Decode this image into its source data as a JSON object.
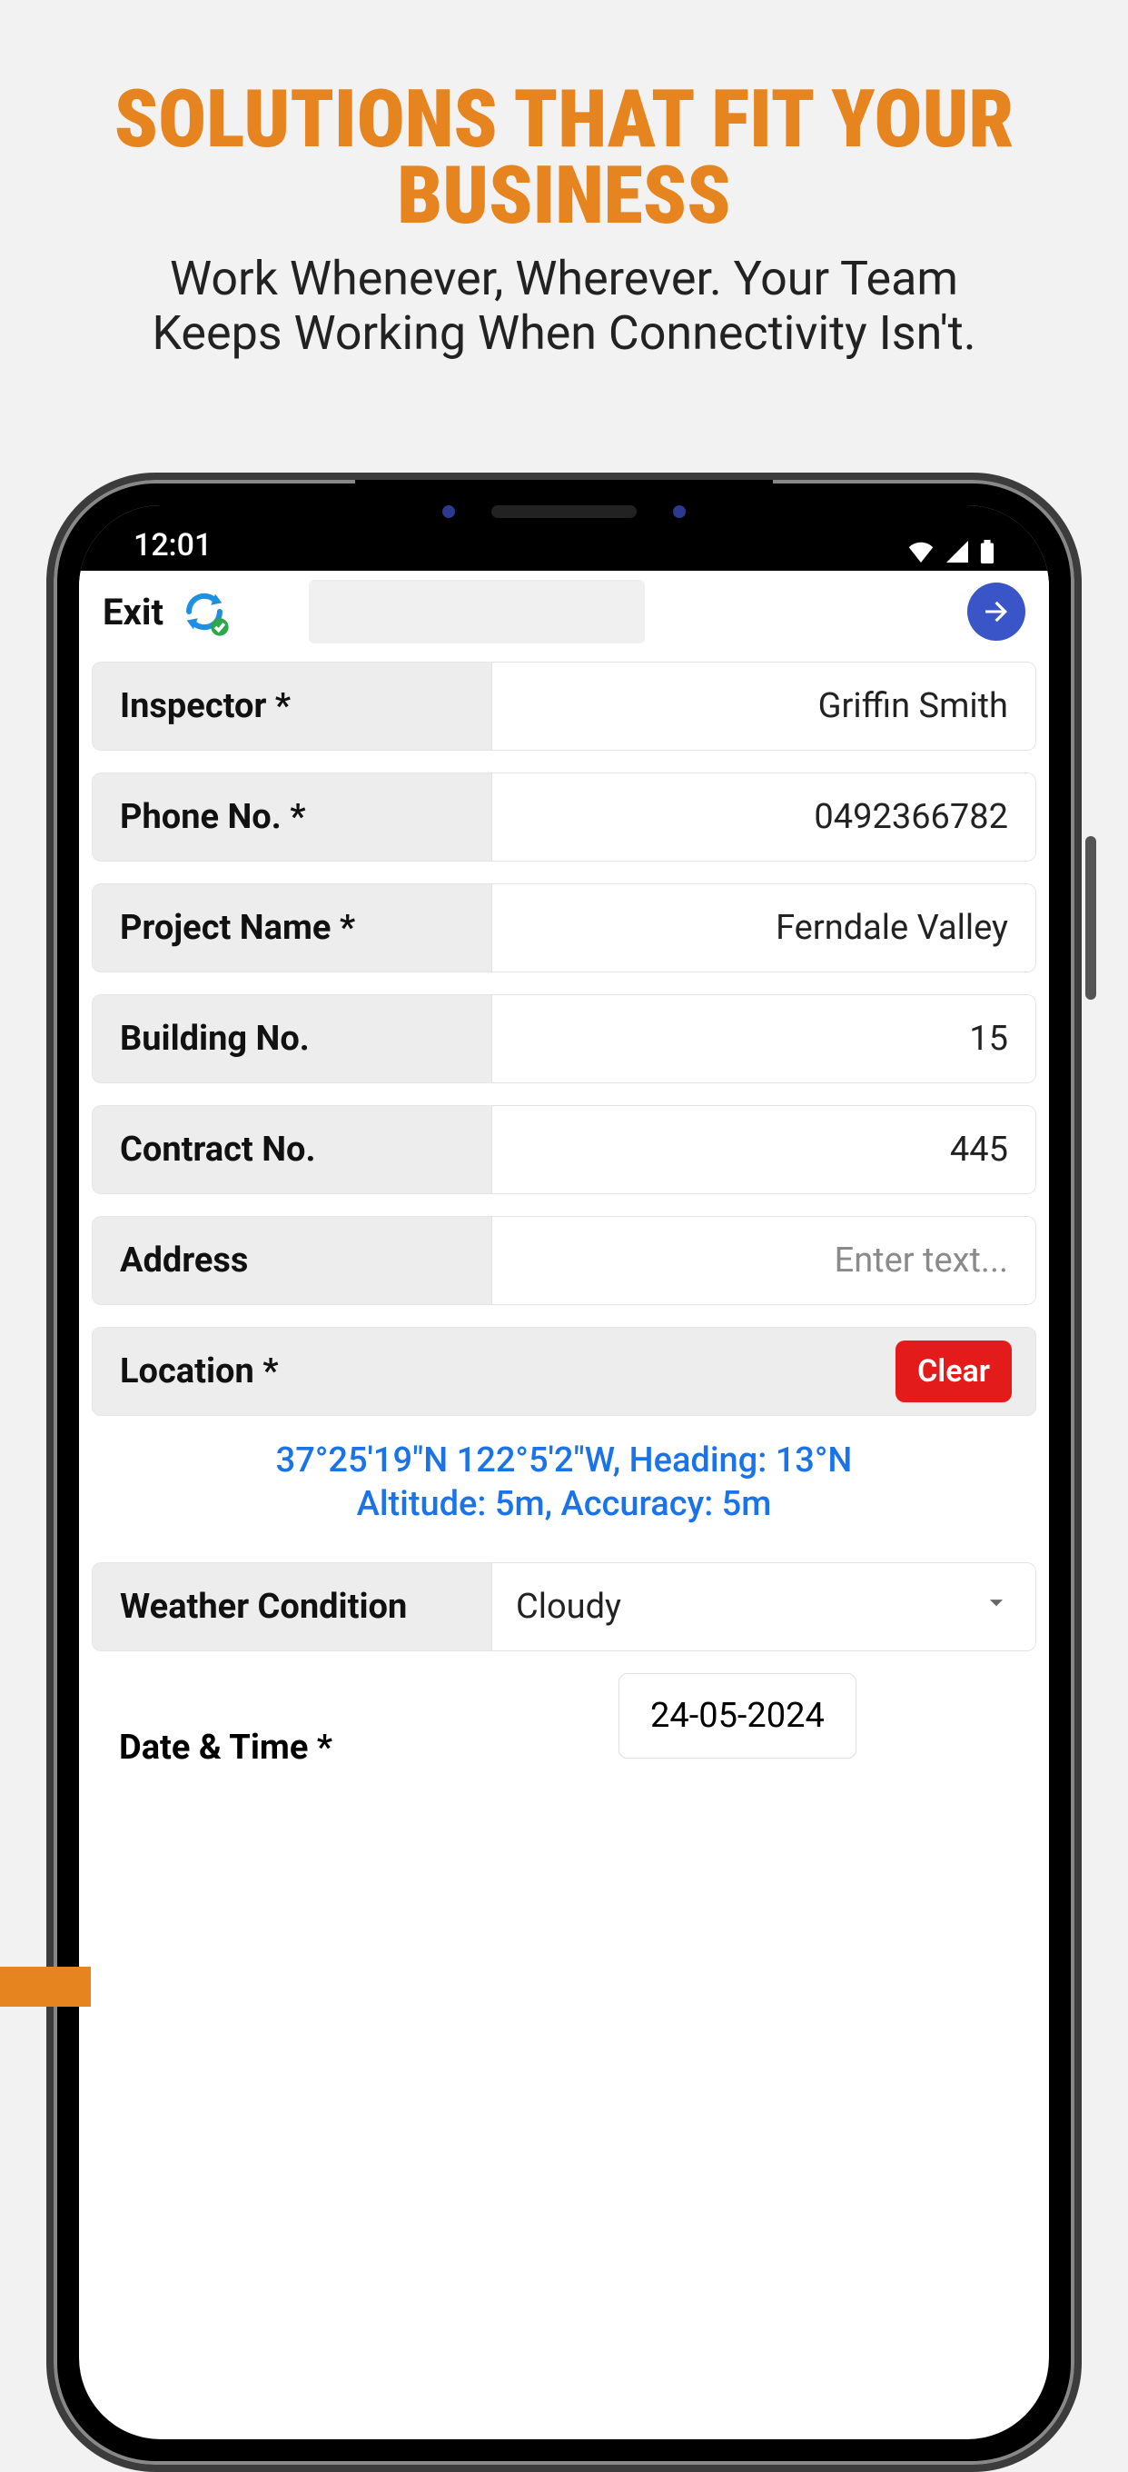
{
  "headline": "SOLUTIONS THAT FIT YOUR BUSINESS",
  "subhead": "Work Whenever, Wherever. Your Team Keeps Working When Connectivity Isn't.",
  "statusbar": {
    "time": "12:01"
  },
  "topbar": {
    "exit": "Exit"
  },
  "fields": {
    "inspector": {
      "label": "Inspector *",
      "value": "Griffin Smith"
    },
    "phone": {
      "label": "Phone No. *",
      "value": "0492366782"
    },
    "project": {
      "label": "Project Name *",
      "value": "Ferndale Valley"
    },
    "building": {
      "label": "Building No.",
      "value": "15"
    },
    "contract": {
      "label": "Contract No.",
      "value": "445"
    },
    "address": {
      "label": "Address",
      "placeholder": "Enter text..."
    },
    "location": {
      "label": "Location *",
      "clear": "Clear",
      "line1": "37°25'19\"N 122°5'2\"W, Heading: 13°N",
      "line2": "Altitude: 5m, Accuracy: 5m"
    },
    "weather": {
      "label": "Weather Condition",
      "value": "Cloudy"
    },
    "datetime": {
      "label": "Date & Time *",
      "date": "24-05-2024"
    }
  }
}
